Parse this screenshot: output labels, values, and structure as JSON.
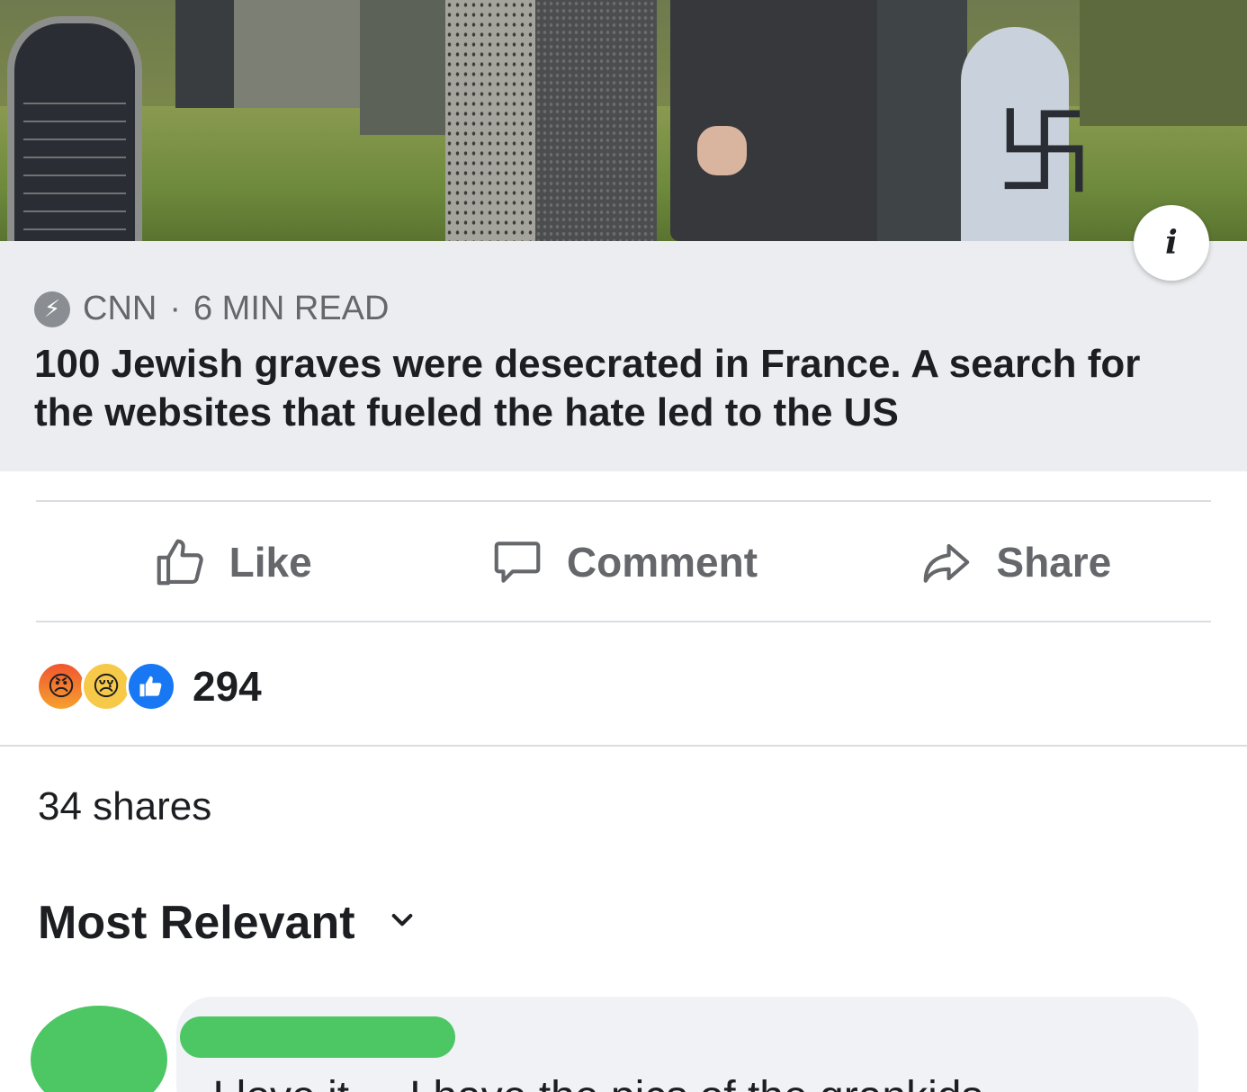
{
  "post": {
    "source_name": "CNN",
    "read_time": "6 MIN READ",
    "separator": "·",
    "headline": "100 Jewish graves were desecrated in France. A search for the websites that fueled the hate led to the US",
    "info_icon": "i"
  },
  "actions": {
    "like_label": "Like",
    "comment_label": "Comment",
    "share_label": "Share"
  },
  "reactions": {
    "icons": [
      "angry-icon",
      "sad-icon",
      "like-icon"
    ],
    "count": "294"
  },
  "shares_text": "34 shares",
  "comments": {
    "sort_label": "Most Relevant",
    "first_comment_text_visible": "I love it ... I have the pics of the grankids"
  },
  "colors": {
    "brand_blue": "#1877f2",
    "secondary_text": "#65676b",
    "preview_bg": "#ebedf0",
    "redaction_green": "#4cc764"
  }
}
